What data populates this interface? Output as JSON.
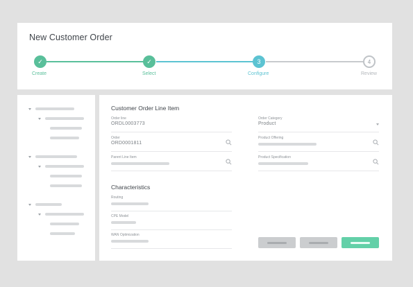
{
  "header": {
    "title": "New Customer Order"
  },
  "steps": [
    {
      "label": "Create",
      "status": "done",
      "marker": "✓"
    },
    {
      "label": "Select",
      "status": "done",
      "marker": "✓"
    },
    {
      "label": "Configure",
      "status": "active",
      "marker": "3"
    },
    {
      "label": "Review",
      "status": "todo",
      "marker": "4"
    }
  ],
  "form": {
    "section_title": "Customer Order Line Item",
    "fields": {
      "order_line": {
        "label": "Order line",
        "value": "ORDL0003773"
      },
      "order_category": {
        "label": "Order Category",
        "value": "Product"
      },
      "order": {
        "label": "Order",
        "value": "ORD0001811"
      },
      "product_offering": {
        "label": "Product Offering",
        "value": ""
      },
      "parent_line_item": {
        "label": "Parent Line Item",
        "value": ""
      },
      "product_specification": {
        "label": "Product Specification",
        "value": ""
      }
    },
    "characteristics_title": "Characteristics",
    "characteristics": {
      "routing": {
        "label": "Routing"
      },
      "cpe_model": {
        "label": "CPE Model"
      },
      "wan_optimization": {
        "label": "WAN Optimization"
      }
    }
  },
  "colors": {
    "accent_green": "#59bf9a",
    "accent_teal": "#5cc3d2",
    "button_green": "#63d0a8",
    "background": "#e1e1e1"
  },
  "icons": [
    "check-icon",
    "search-icon",
    "chevron-down-icon",
    "caret-down-icon"
  ]
}
